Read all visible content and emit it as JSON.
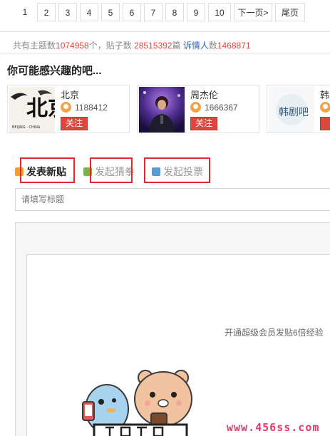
{
  "pagination": {
    "pages": [
      "1",
      "2",
      "3",
      "4",
      "5",
      "6",
      "7",
      "8",
      "9",
      "10"
    ],
    "next": "下一页>",
    "last": "尾页"
  },
  "stats": {
    "topics_label": "共有主题数",
    "topics": "1074958",
    "topics_unit": "个，贴子数 ",
    "posts": "28515392",
    "posts_unit": "篇 ",
    "fans_label": "诉情人",
    "fans_suffix": "数",
    "fans": "1468871"
  },
  "interest": {
    "title": "你可能感兴趣的吧...",
    "cards": [
      {
        "name": "北京",
        "count": "1188412",
        "follow": "关注",
        "thumb_text": "北京",
        "thumb_sub": "BEIJING · CHINA"
      },
      {
        "name": "周杰伦",
        "count": "1666367",
        "follow": "关注"
      },
      {
        "name": "韩",
        "thumb_text": "韩剧吧"
      }
    ]
  },
  "post_tabs": [
    {
      "label": "发表新贴",
      "color": "#f0a030"
    },
    {
      "label": "发起猜拳",
      "color": "#7cb342"
    },
    {
      "label": "发起投票",
      "color": "#5b9bd5"
    }
  ],
  "editor": {
    "title_placeholder": "请填写标题",
    "vip_tip": "开通超级会员发贴6倍经验"
  },
  "watermark": "www.456ss.com",
  "colors": {
    "accent_red": "#e0463f",
    "link_blue": "#2d64b3",
    "highlight_box": "#e0282a"
  }
}
